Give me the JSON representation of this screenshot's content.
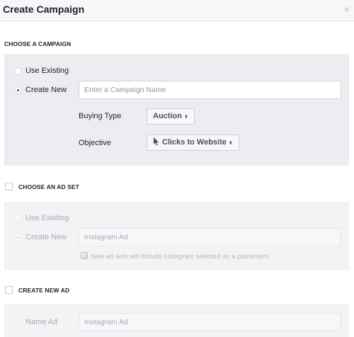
{
  "header": {
    "title": "Create Campaign",
    "close_glyph": "×"
  },
  "campaign": {
    "section_label": "CHOOSE A CAMPAIGN",
    "options": [
      {
        "label": "Use Existing",
        "selected": false
      },
      {
        "label": "Create New",
        "selected": true
      }
    ],
    "name_placeholder": "Enter a Campaign Name",
    "buying_type_label": "Buying Type",
    "buying_type_value": "Auction",
    "objective_label": "Objective",
    "objective_value": "Clicks to Website",
    "objective_icon": "cursor-icon",
    "caret": "⬍"
  },
  "ad_set": {
    "section_label": "CHOOSE AN AD SET",
    "checked": false,
    "options": [
      {
        "label": "Use Existing",
        "selected": false
      },
      {
        "label": "Create New",
        "selected": true
      }
    ],
    "name_value": "Instagram Ad",
    "note": "New ad sets will include Instagram selected as a placement.",
    "note_icon": "instagram-icon"
  },
  "ad": {
    "section_label": "CREATE NEW AD",
    "checked": false,
    "name_label": "Name Ad",
    "name_value": "Instagram Ad"
  }
}
